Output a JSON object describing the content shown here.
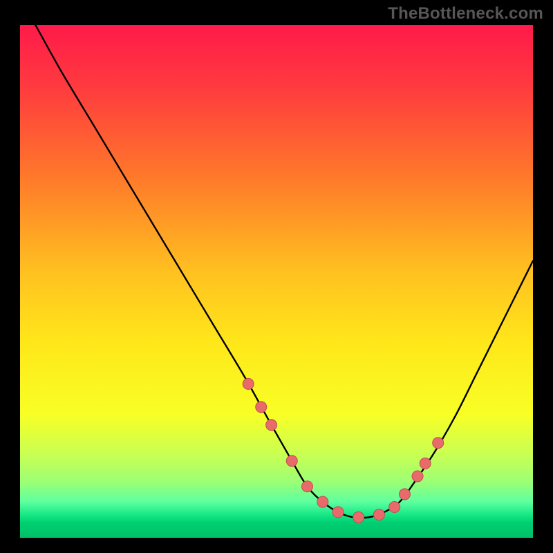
{
  "watermark": "TheBottleneck.com",
  "colors": {
    "bg": "#000000",
    "curve": "#000000",
    "marker_fill": "#e86a6b",
    "marker_stroke": "#c04d4f",
    "gradient_stops": [
      {
        "offset": 0.0,
        "color": "#ff1a4a"
      },
      {
        "offset": 0.12,
        "color": "#ff3a3f"
      },
      {
        "offset": 0.3,
        "color": "#ff7a2a"
      },
      {
        "offset": 0.48,
        "color": "#ffc020"
      },
      {
        "offset": 0.62,
        "color": "#ffe71a"
      },
      {
        "offset": 0.76,
        "color": "#f8ff25"
      },
      {
        "offset": 0.84,
        "color": "#c7ff54"
      },
      {
        "offset": 0.89,
        "color": "#9dff74"
      },
      {
        "offset": 0.93,
        "color": "#5effa0"
      },
      {
        "offset": 0.955,
        "color": "#16e886"
      },
      {
        "offset": 0.97,
        "color": "#00d072"
      },
      {
        "offset": 1.0,
        "color": "#00c066"
      }
    ]
  },
  "chart_data": {
    "type": "line",
    "title": "",
    "xlabel": "",
    "ylabel": "",
    "xlim": [
      0,
      100
    ],
    "ylim": [
      0,
      100
    ],
    "grid": false,
    "legend": false,
    "series": [
      {
        "name": "bottleneck-curve",
        "x": [
          3,
          8,
          14,
          20,
          26,
          32,
          38,
          44,
          49,
          53,
          56,
          59,
          62,
          65,
          68,
          71,
          74,
          77,
          81,
          85,
          89,
          93,
          97,
          100
        ],
        "y": [
          100,
          91,
          81,
          71,
          61,
          51,
          41,
          31,
          22,
          15,
          10,
          7,
          5,
          4,
          4,
          5,
          7,
          11,
          17,
          24,
          32,
          40,
          48,
          54
        ]
      }
    ],
    "markers": {
      "name": "highlight-points",
      "x": [
        44.5,
        47.0,
        49.0,
        53.0,
        56.0,
        59.0,
        62.0,
        66.0,
        70.0,
        73.0,
        75.0,
        77.5,
        79.0,
        81.5
      ],
      "y": [
        30.0,
        25.5,
        22.0,
        15.0,
        10.0,
        7.0,
        5.0,
        4.0,
        4.5,
        6.0,
        8.5,
        12.0,
        14.5,
        18.5
      ]
    }
  }
}
